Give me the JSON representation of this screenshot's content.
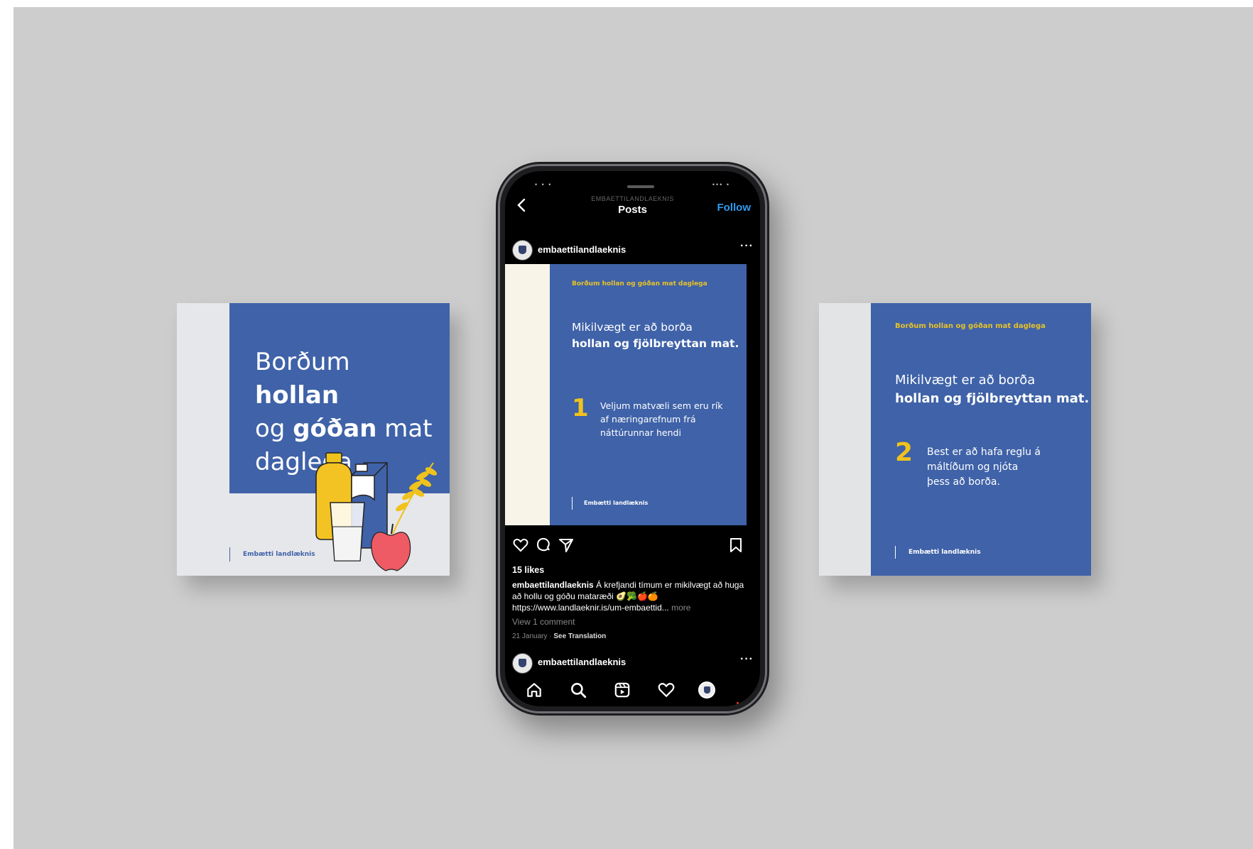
{
  "left_card": {
    "headline": {
      "w1": "Borðum",
      "w2": "hollan",
      "w3": "og",
      "w4": "góðan",
      "w5": "mat",
      "w6": "daglega"
    },
    "brand": "Embætti landlæknis"
  },
  "right_card": {
    "tag": "Borðum hollan og góðan mat daglega",
    "intro_line1": "Mikilvægt er að borða",
    "intro_line2": "hollan og fjölbreyttan mat.",
    "number": "2",
    "tip": "Best er að hafa reglu á máltíðum og njóta þess að borða.",
    "brand": "Embætti landlæknis"
  },
  "phone": {
    "header": {
      "subtitle": "EMBAETTILANDLAEKNIS",
      "title": "Posts",
      "follow_label": "Follow"
    },
    "post": {
      "username": "embaettilandlaeknis",
      "image": {
        "tag": "Borðum hollan og góðan mat daglega",
        "intro_line1": "Mikilvægt er að borða",
        "intro_line2": "hollan og fjölbreyttan mat.",
        "number": "1",
        "tip": "Veljum matvæli sem eru rík af næringarefnum frá náttúrunnar hendi",
        "brand": "Embætti landlæknis"
      },
      "likes": "15 likes",
      "caption_user": "embaettilandlaeknis",
      "caption_text": "Á krefjandi tímum er mikilvægt að huga að hollu og góðu mataræði 🥑🥦🍎🍊",
      "caption_link": "https://www.landlaeknir.is/um-embaettid...",
      "more_label": "more",
      "view_comments": "View 1 comment",
      "date": "21 January",
      "see_translation": "See Translation"
    },
    "next_post": {
      "username": "embaettilandlaeknis"
    },
    "tabs": [
      "home-icon",
      "search-icon",
      "reels-icon",
      "heart-icon",
      "profile-icon"
    ]
  },
  "colors": {
    "brand_blue": "#3f62a8",
    "accent_yellow": "#f0c21c",
    "follow_blue": "#2e9bf0",
    "background": "#cdcdcd"
  }
}
